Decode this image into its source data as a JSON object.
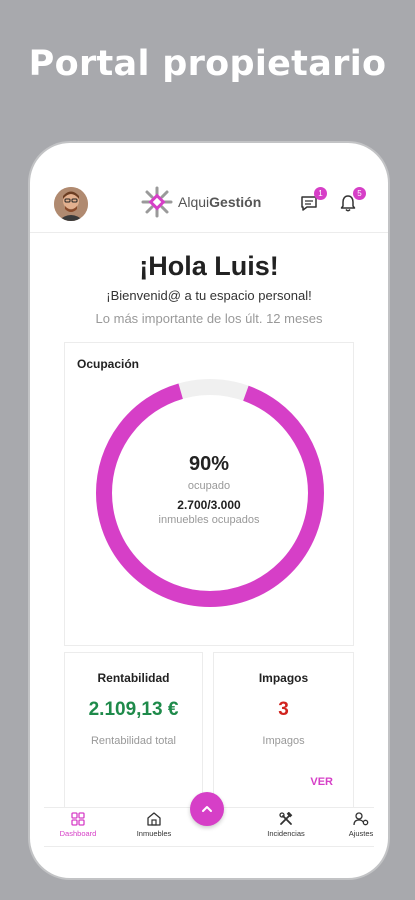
{
  "header": {
    "banner_title": "Portal propietario"
  },
  "app": {
    "logo_text_prefix": "Alqui",
    "logo_text_bold": "Gestión",
    "messages_badge": "1",
    "notifications_badge": "5"
  },
  "greeting": {
    "title": "¡Hola Luis!",
    "welcome": "¡Bienvenid@ a tu espacio personal!",
    "period": "Lo más importante de los últ. 12 meses"
  },
  "occupancy": {
    "title": "Ocupación",
    "percent_label": "90%",
    "percent_value": 0.9,
    "percent_sub": "ocupado",
    "ratio": "2.700/3.000",
    "ratio_sub": "inmuebles ocupados"
  },
  "rentabilidad": {
    "title": "Rentabilidad",
    "value": "2.109,13 €",
    "sub": "Rentabilidad total",
    "color": "#1e8a4a"
  },
  "impagos": {
    "title": "Impagos",
    "value": "3",
    "sub": "Impagos",
    "link": "VER",
    "color": "#d1241f"
  },
  "nav": {
    "items": [
      {
        "label": "Dashboard",
        "icon": "dashboard-icon",
        "active": true
      },
      {
        "label": "Inmuebles",
        "icon": "building-icon",
        "active": false
      },
      {
        "label": "Incidencias",
        "icon": "tools-icon",
        "active": false
      },
      {
        "label": "Ajustes",
        "icon": "settings-icon",
        "active": false
      }
    ]
  },
  "colors": {
    "accent": "#d63fc7",
    "background": "#a8a9ad"
  }
}
